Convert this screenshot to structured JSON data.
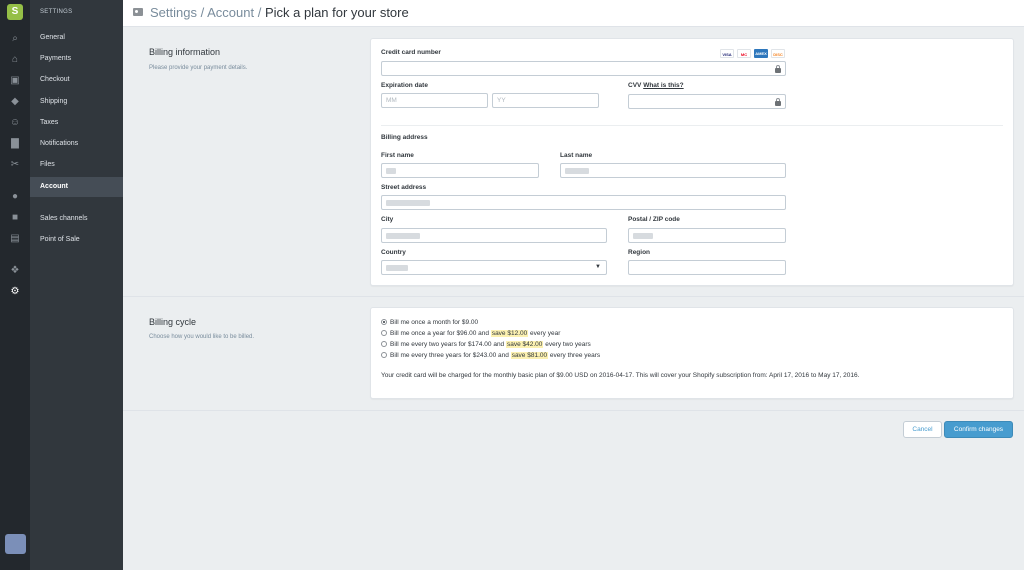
{
  "app": {
    "logo_glyph": "S"
  },
  "iconbar": {
    "icons": [
      "search-icon",
      "home-icon",
      "orders-icon",
      "products-icon",
      "customers-icon",
      "reports-icon",
      "discounts-icon",
      "location-icon",
      "facebook-icon",
      "point-of-sale-icon",
      "apps-icon",
      "settings-icon"
    ]
  },
  "subnav": {
    "heading": "SETTINGS",
    "items": [
      {
        "label": "General"
      },
      {
        "label": "Payments"
      },
      {
        "label": "Checkout"
      },
      {
        "label": "Shipping"
      },
      {
        "label": "Taxes"
      },
      {
        "label": "Notifications"
      },
      {
        "label": "Files"
      },
      {
        "label": "Account",
        "active": true
      },
      {
        "label": "Sales channels"
      },
      {
        "label": "Point of Sale"
      }
    ]
  },
  "breadcrumb": {
    "part1": "Settings",
    "sep": " / ",
    "part2": "Account",
    "current": "Pick a plan for your store"
  },
  "billing_info": {
    "title": "Billing information",
    "description": "Please provide your payment details.",
    "credit_card_label": "Credit card number",
    "card_logos": [
      "VISA",
      "MC",
      "AMEX",
      "DISC"
    ],
    "expiration_label": "Expiration date",
    "mm_placeholder": "MM",
    "yy_placeholder": "YY",
    "cvv_label": "CVV",
    "cvv_link": "What is this?",
    "address_heading": "Billing address",
    "first_name_label": "First name",
    "last_name_label": "Last name",
    "street_label": "Street address",
    "city_label": "City",
    "postal_label": "Postal / ZIP code",
    "country_label": "Country",
    "region_label": "Region"
  },
  "billing_cycle": {
    "title": "Billing cycle",
    "description": "Choose how you would like to be billed.",
    "options": [
      {
        "pre": "Bill me once a month for $9.00",
        "save": "",
        "post": "",
        "selected": true
      },
      {
        "pre": "Bill me once a year for $96.00 and ",
        "save": "save $12.00",
        "post": " every year",
        "selected": false
      },
      {
        "pre": "Bill me every two years for $174.00 and ",
        "save": "save $42.00",
        "post": " every two years",
        "selected": false
      },
      {
        "pre": "Bill me every three years for $243.00 and ",
        "save": "save $81.00",
        "post": " every three years",
        "selected": false
      }
    ],
    "note": "Your credit card will be charged for the monthly basic plan of $9.00 USD on 2016-04-17. This will cover your Shopify subscription from: April 17, 2016 to May 17, 2016."
  },
  "actions": {
    "cancel_label": "Cancel",
    "confirm_label": "Confirm changes"
  },
  "colors": {
    "accent": "#479ccf",
    "brand": "#95bf47",
    "highlight": "#fcf1b1"
  }
}
